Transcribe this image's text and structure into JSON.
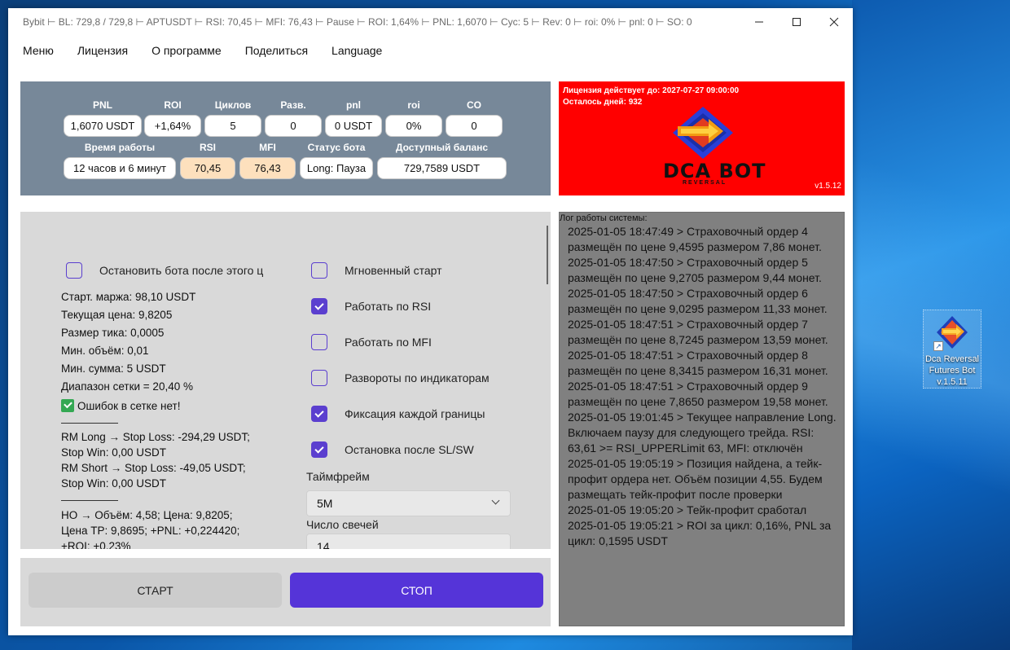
{
  "window": {
    "title": "Bybit ⊢ BL: 729,8 / 729,8 ⊢ APTUSDT ⊢ RSI: 70,45 ⊢ MFI: 76,43 ⊢ Pause ⊢ ROI: 1,64% ⊢ PNL: 1,6070 ⊢ Cyc: 5 ⊢ Rev: 0 ⊢ roi: 0% ⊢ pnl: 0 ⊢ SO: 0"
  },
  "menu": [
    "Меню",
    "Лицензия",
    "О программе",
    "Поделиться",
    "Language"
  ],
  "stats": {
    "row1": [
      {
        "label": "PNL",
        "value": "1,6070 USDT"
      },
      {
        "label": "ROI",
        "value": "+1,64%"
      },
      {
        "label": "Циклов",
        "value": "5"
      },
      {
        "label": "Разв.",
        "value": "0"
      },
      {
        "label": "pnl",
        "value": "0 USDT"
      },
      {
        "label": "roi",
        "value": "0%"
      },
      {
        "label": "CO",
        "value": "0"
      }
    ],
    "row2": [
      {
        "label": "Время работы",
        "value": "12 часов и 6 минут"
      },
      {
        "label": "RSI",
        "value": "70,45"
      },
      {
        "label": "MFI",
        "value": "76,43"
      },
      {
        "label": "Статус бота",
        "value": "Long: Пауза"
      },
      {
        "label": "Доступный баланс",
        "value": "729,7589 USDT"
      }
    ]
  },
  "license": {
    "valid_until": "Лицензия действует до: 2027-07-27 09:00:00",
    "days_left": "Осталось дней: 932",
    "logo_text": "DCA BOT",
    "logo_sub": "REVERSAL",
    "version": "v1.5.12"
  },
  "settings": {
    "left_checkbox": {
      "label": "Остановить бота после этого ц",
      "checked": false
    },
    "info": [
      "Старт. маржа: 98,10 USDT",
      "Текущая цена: 9,8205",
      "Размер тика: 0,0005",
      "Мин. объём: 0,01",
      "Мин. сумма: 5 USDT",
      "Диапазон сетки = 20,40 %"
    ],
    "grid_ok": "Ошибок в сетке нет!",
    "rm_lines": [
      "RM Long → Stop Loss: -294,29 USDT;",
      "Stop Win: 0,00 USDT",
      "RM Short → Stop Loss: -49,05 USDT;",
      "Stop Win: 0,00 USDT"
    ],
    "ho_lines": [
      "HO → Объём: 4,58; Цена: 9,8205;",
      "Цена TP: 9,8695; +PNL: +0,224420;",
      "+ROI: +0,23%"
    ],
    "right_checkboxes": [
      {
        "label": "Мгновенный старт",
        "checked": false
      },
      {
        "label": "Работать по RSI",
        "checked": true
      },
      {
        "label": "Работать по MFI",
        "checked": false
      },
      {
        "label": "Развороты по индикаторам",
        "checked": false
      },
      {
        "label": "Фиксация каждой границы",
        "checked": true
      },
      {
        "label": "Остановка после SL/SW",
        "checked": true
      }
    ],
    "timeframe_label": "Таймфрейм",
    "timeframe_value": "5M",
    "candles_label": "Число свечей",
    "candles_value": "14"
  },
  "buttons": {
    "start": "СТАРТ",
    "stop": "СТОП"
  },
  "log": {
    "title": "Лог работы системы:",
    "entries": [
      "2025-01-05 18:47:49 > Страховочный ордер 4 размещён по цене 9,4595 размером 7,86 монет.",
      "2025-01-05 18:47:50 > Страховочный ордер 5 размещён по цене 9,2705 размером 9,44 монет.",
      "2025-01-05 18:47:50 > Страховочный ордер 6 размещён по цене 9,0295 размером 11,33 монет.",
      "2025-01-05 18:47:51 > Страховочный ордер 7 размещён по цене 8,7245 размером 13,59 монет.",
      "2025-01-05 18:47:51 > Страховочный ордер 8 размещён по цене 8,3415 размером 16,31 монет.",
      "2025-01-05 18:47:51 > Страховочный ордер 9 размещён по цене 7,8650 размером 19,58 монет.",
      "2025-01-05 19:01:45 > Текущее направление Long. Включаем паузу для следующего трейда. RSI: 63,61 >= RSI_UPPERLimit 63, MFI: отключён",
      "2025-01-05 19:05:19 > Позиция найдена, а тейк-профит ордера нет. Объём позиции 4,55. Будем размещать тейк-профит после проверки",
      "2025-01-05 19:05:20 > Тейк-профит сработал",
      "2025-01-05 19:05:21 > ROI за цикл: 0,16%, PNL за цикл: 0,1595 USDT"
    ]
  },
  "desktop": {
    "icon_label": "Dca Reversal Futures Bot v.1.5.11"
  },
  "colors": {
    "accent": "#5534d8",
    "stats_bg": "#778899",
    "license_bg": "#ff0000",
    "log_bg": "#808080"
  }
}
